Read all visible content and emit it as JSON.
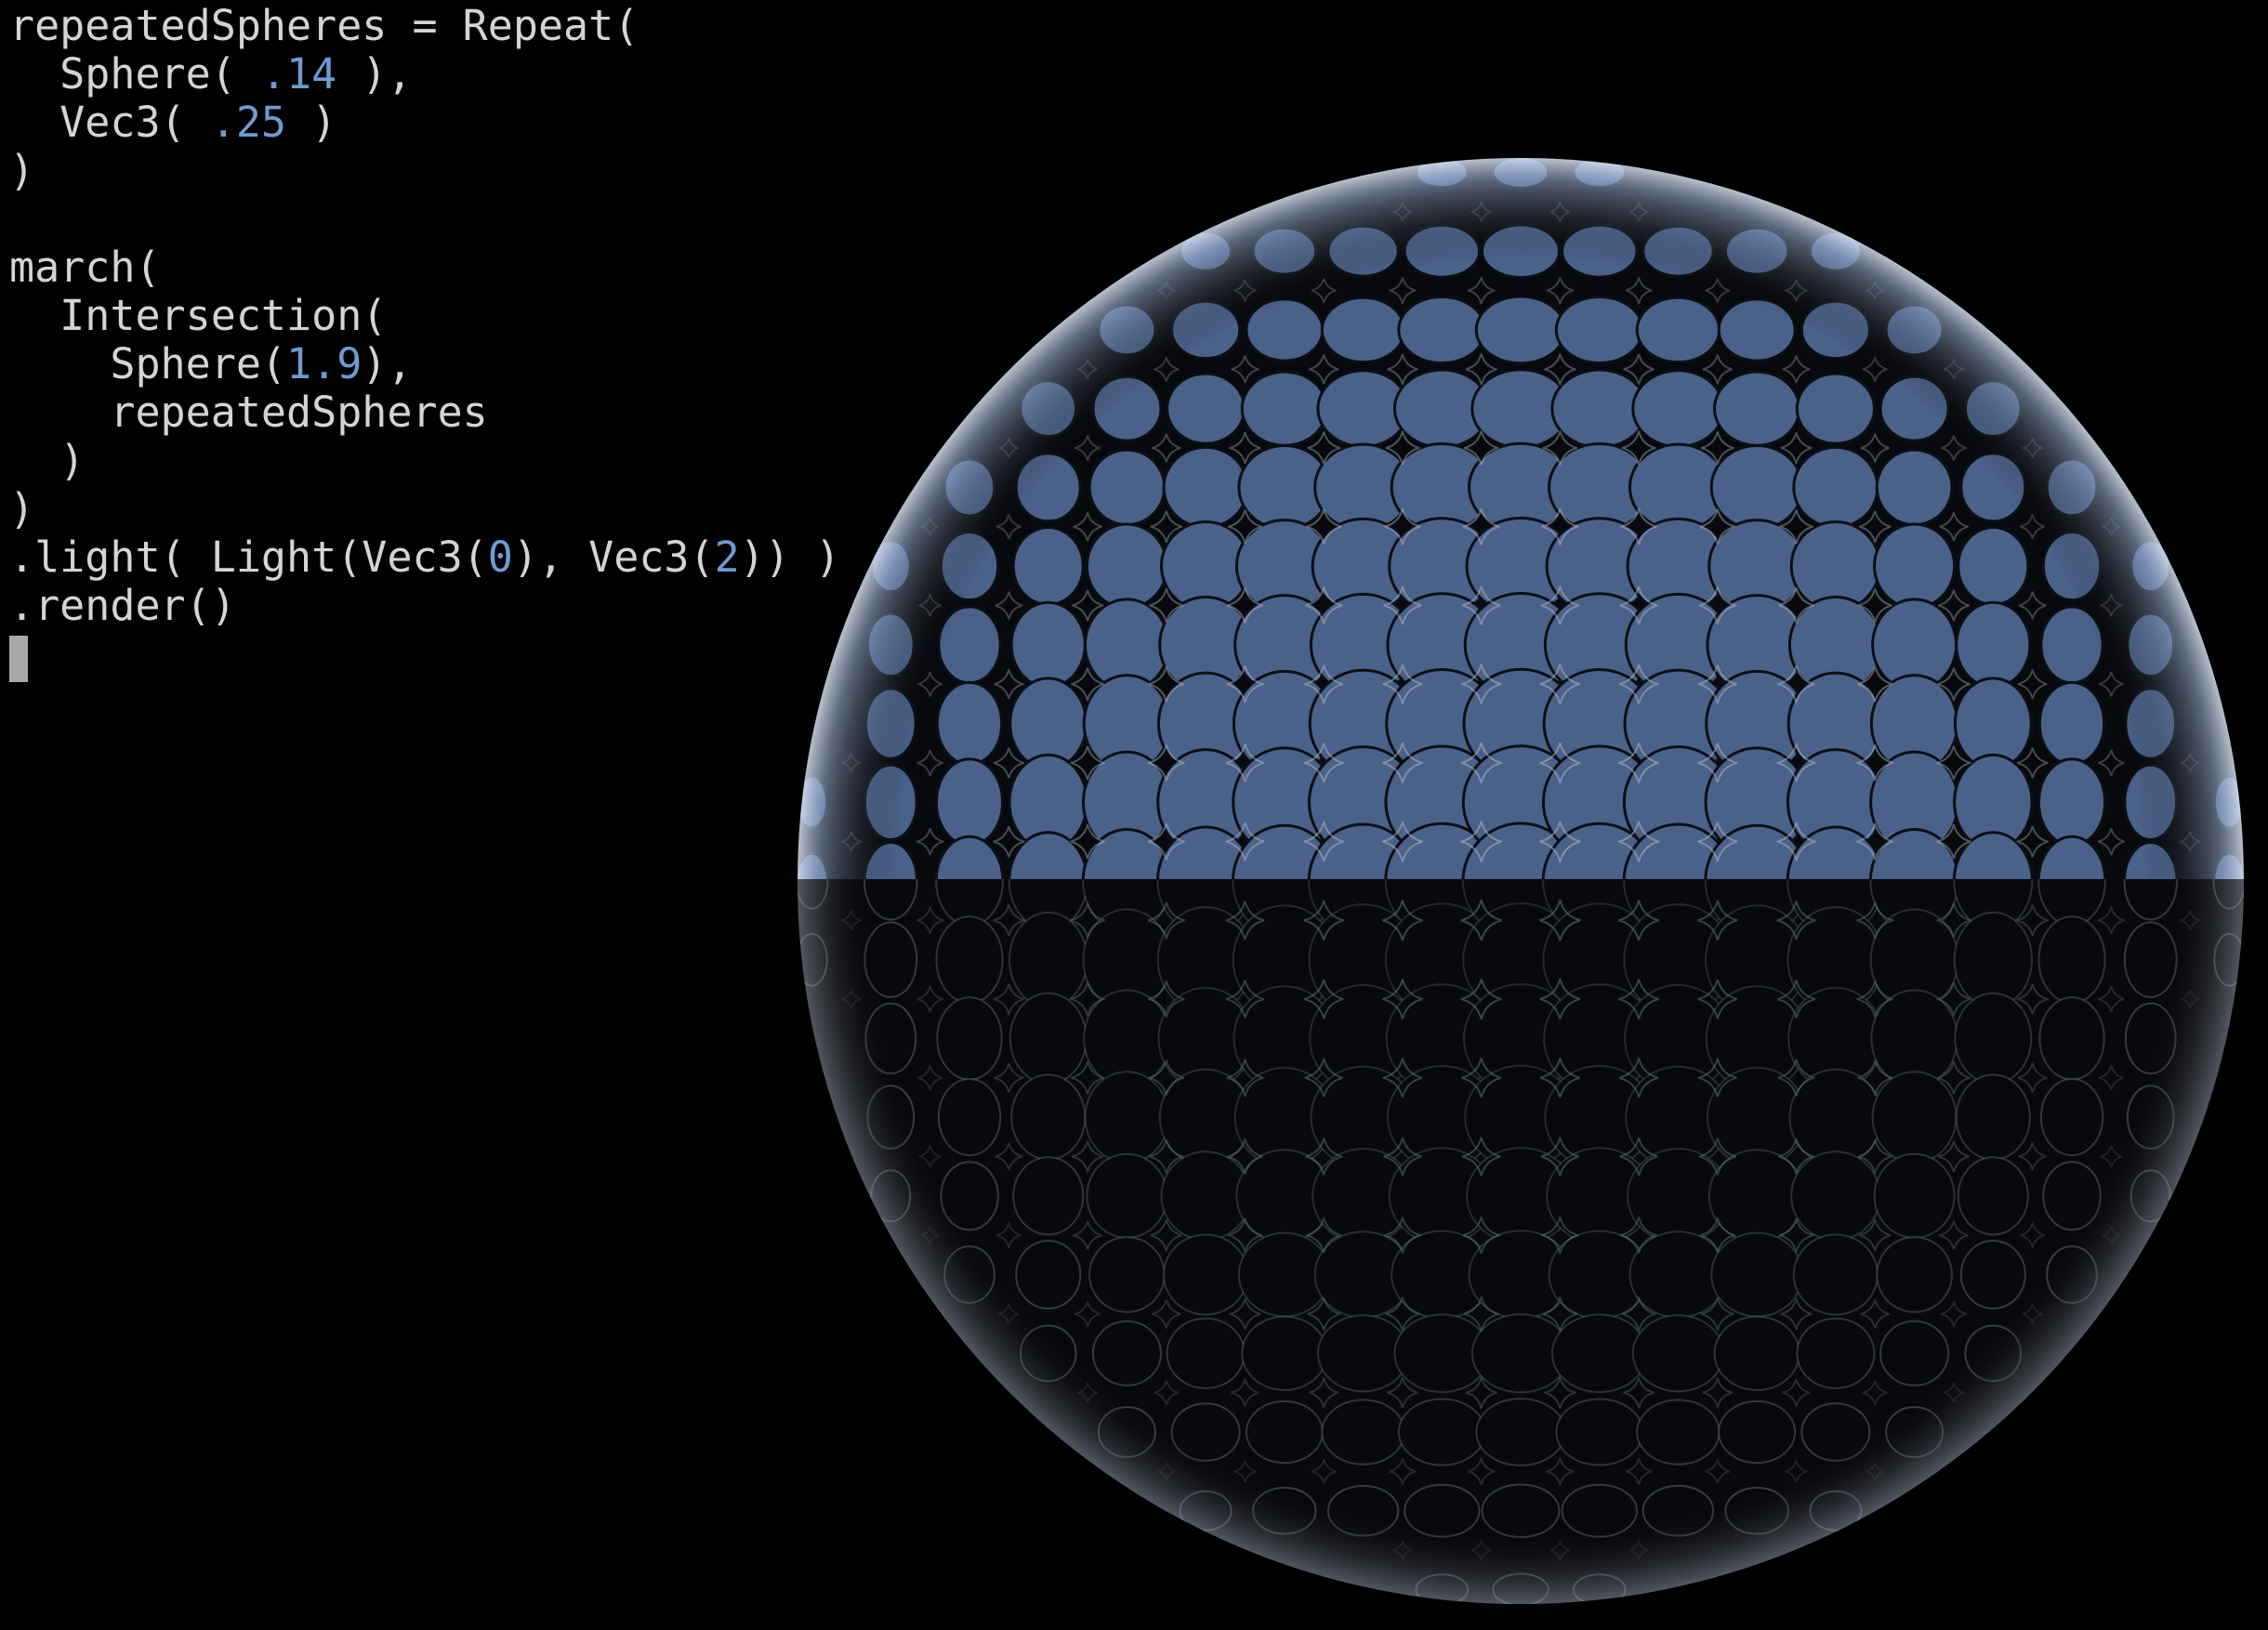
{
  "editor": {
    "lines": [
      [
        {
          "t": "repeatedSpheres = Repeat(",
          "k": "txt"
        }
      ],
      [
        {
          "t": "  Sphere( ",
          "k": "txt"
        },
        {
          "t": ".14",
          "k": "num"
        },
        {
          "t": " ),",
          "k": "txt"
        }
      ],
      [
        {
          "t": "  Vec3( ",
          "k": "txt"
        },
        {
          "t": ".25",
          "k": "num"
        },
        {
          "t": " )",
          "k": "txt"
        }
      ],
      [
        {
          "t": ")",
          "k": "txt"
        }
      ],
      [
        {
          "t": "",
          "k": "txt"
        }
      ],
      [
        {
          "t": "march(",
          "k": "txt"
        }
      ],
      [
        {
          "t": "  Intersection(",
          "k": "txt"
        }
      ],
      [
        {
          "t": "    Sphere(",
          "k": "txt"
        },
        {
          "t": "1.9",
          "k": "num"
        },
        {
          "t": "),",
          "k": "txt"
        }
      ],
      [
        {
          "t": "    repeatedSpheres",
          "k": "txt"
        }
      ],
      [
        {
          "t": "  )",
          "k": "txt"
        }
      ],
      [
        {
          "t": ")",
          "k": "txt"
        }
      ],
      [
        {
          "t": ".light( Light(Vec3(",
          "k": "txt"
        },
        {
          "t": "0",
          "k": "num"
        },
        {
          "t": "), Vec3(",
          "k": "txt"
        },
        {
          "t": "2",
          "k": "num"
        },
        {
          "t": ")) )",
          "k": "txt"
        }
      ],
      [
        {
          "t": ".render()",
          "k": "txt"
        }
      ]
    ]
  },
  "render": {
    "description_icon": "raymarched-sphere-render",
    "colors": {
      "background": "#000000",
      "lit_face": "#4a6189",
      "lit_face_highlight": "#7d97c0",
      "shadow_face": "#07090d",
      "rim": "#c9d4e6",
      "code_text": "#d4d4d4",
      "code_number": "#6f9bd1",
      "cursor": "#a8a8a8"
    }
  }
}
